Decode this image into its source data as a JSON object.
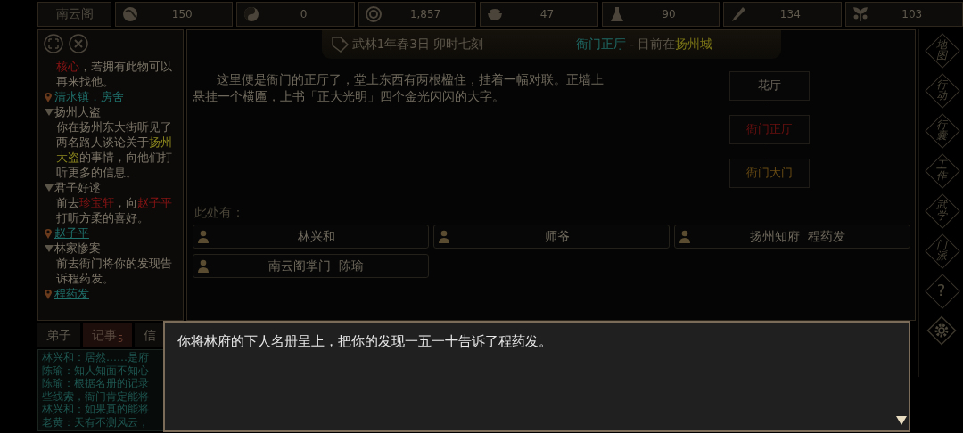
{
  "status_bar": {
    "sect": "南云阁",
    "stats": [
      "150",
      "0",
      "1,857",
      "47",
      "90",
      "134",
      "103"
    ]
  },
  "quest_panel": {
    "fragment": {
      "segments": [
        {
          "text": "核心",
          "kind": "target"
        },
        {
          "text": "，若拥有此物可以再来找他。",
          "kind": "text"
        }
      ],
      "location": "清水镇，房舍"
    },
    "quests": [
      {
        "title": "扬州大盗",
        "expanded": true,
        "segments": [
          {
            "text": "你在扬州东大街听见了两名路人谈论关于",
            "kind": "text"
          },
          {
            "text": "扬州大盗",
            "kind": "keyword"
          },
          {
            "text": "的事情，向他们打听更多的信息。",
            "kind": "text"
          }
        ]
      },
      {
        "title": "君子好逑",
        "expanded": true,
        "segments": [
          {
            "text": "前去",
            "kind": "text"
          },
          {
            "text": "珍宝轩",
            "kind": "target"
          },
          {
            "text": "，向",
            "kind": "text"
          },
          {
            "text": "赵子平",
            "kind": "target"
          },
          {
            "text": "打听方柔的喜好。",
            "kind": "text"
          }
        ],
        "location": "赵子平"
      },
      {
        "title": "林家惨案",
        "expanded": true,
        "segments": [
          {
            "text": "前去衙门将你的发现告诉程药发。",
            "kind": "text"
          }
        ],
        "location": "程药发"
      }
    ]
  },
  "header": {
    "date": "武林1年春3日 卯时七刻",
    "room": "衙门正厅",
    "separator": "-",
    "prefix": "目前在",
    "city": "扬州城"
  },
  "description": "这里便是衙门的正厅了，堂上东西有两根楹住，挂着一幅对联。正墙上悬挂一个横匾，上书「正大光明」四个金光闪闪的大字。",
  "map": [
    {
      "label": "花厅",
      "kind": "room",
      "selected": false
    },
    {
      "label": "衙门正厅",
      "kind": "room",
      "selected": true
    },
    {
      "label": "衙门大门",
      "kind": "exit",
      "selected": false
    }
  ],
  "present_label": "此处有：",
  "npcs": [
    "林兴和",
    "师爷",
    "扬州知府  程药发",
    "南云阁掌门  陈瑜"
  ],
  "side_menu": [
    "地图",
    "行动",
    "行囊",
    "工作",
    "武学",
    "门派",
    "?"
  ],
  "tabs": [
    {
      "label": "弟子",
      "selected": false
    },
    {
      "label": "记事",
      "badge": "5",
      "selected": true
    },
    {
      "label": "信",
      "selected": false
    }
  ],
  "log": [
    "林兴和：居然……是府",
    "陈瑜：知人知面不知心",
    "陈瑜：根据名册的记录",
    "些线索，衙门肯定能将",
    "林兴和：如果真的能将",
    "老黄：天有不测风云，"
  ],
  "dialog": {
    "text": "你将林府的下人名册呈上，把你的发现一五一十告诉了程药发。"
  }
}
